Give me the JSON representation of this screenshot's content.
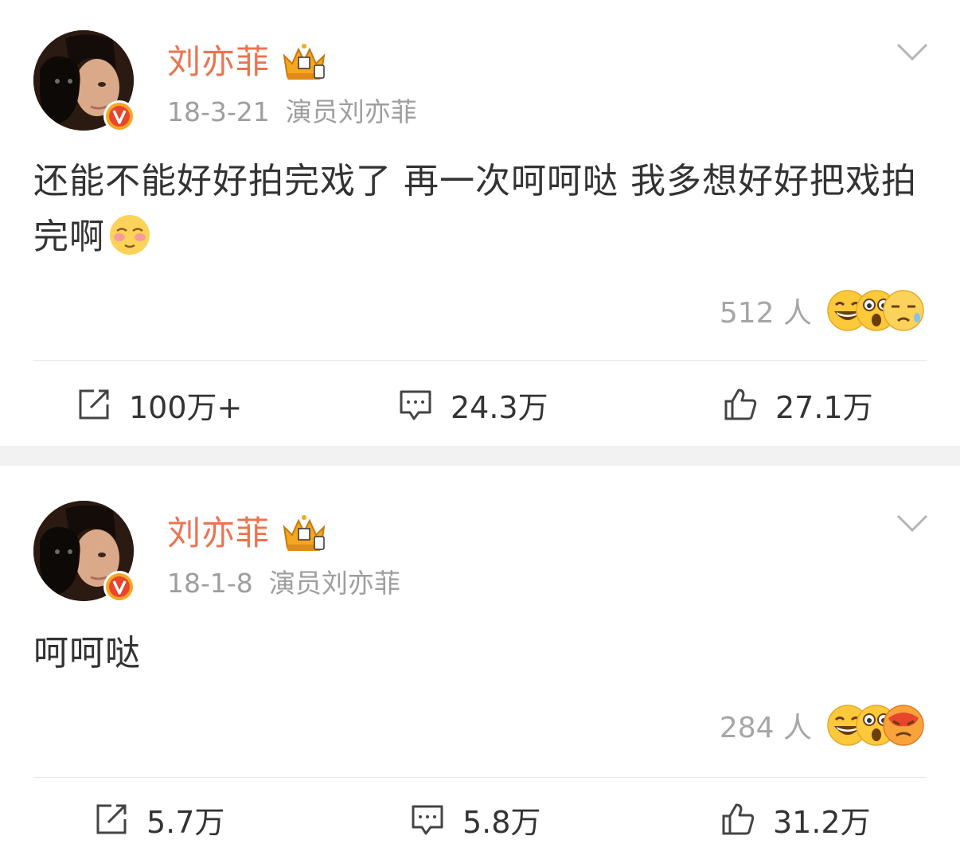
{
  "posts": [
    {
      "username": "刘亦菲",
      "date": "18-3-21",
      "source": "演员刘亦菲",
      "text": "还能不能好好拍完戏了 再一次呵呵哒 我多想好好把戏拍完啊",
      "reaction_count": "512 人",
      "actions": {
        "repost": "100万+",
        "comment": "24.3万",
        "like": "27.1万"
      }
    },
    {
      "username": "刘亦菲",
      "date": "18-1-8",
      "source": "演员刘亦菲",
      "text": "呵呵哒",
      "reaction_count": "284 人",
      "actions": {
        "repost": "5.7万",
        "comment": "5.8万",
        "like": "31.2万"
      }
    }
  ],
  "colors": {
    "username": "#eb7350",
    "meta": "#9e9e9e",
    "badge": "#f5a623",
    "separator": "#f2f2f2"
  },
  "icons": [
    "avatar",
    "verified-badge-icon",
    "crown-level-icon",
    "chevron-down-icon",
    "shy-emoji-icon",
    "laugh-emoji-icon",
    "surprised-emoji-icon",
    "sad-emoji-icon",
    "angry-emoji-icon",
    "repost-icon",
    "comment-icon",
    "like-icon"
  ]
}
